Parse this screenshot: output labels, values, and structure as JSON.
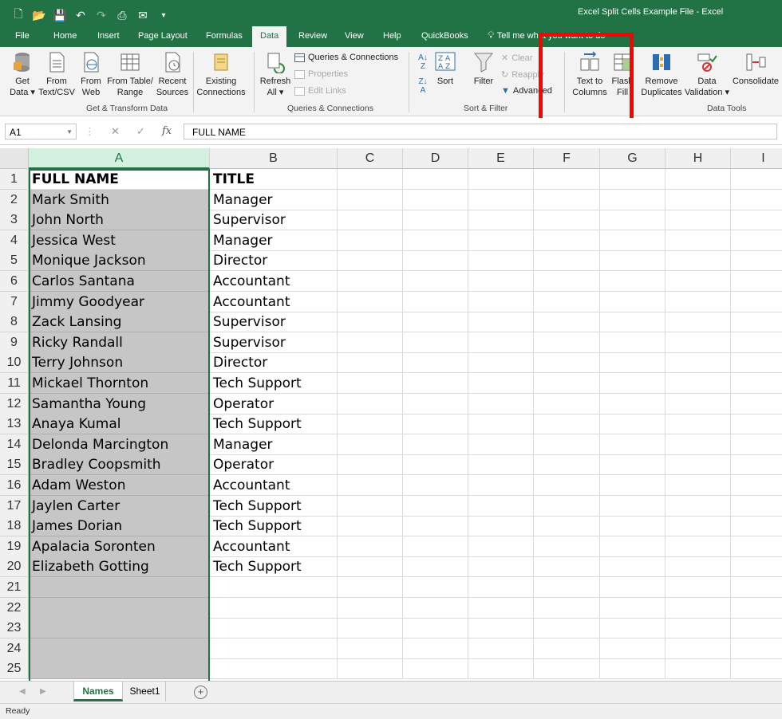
{
  "window": {
    "title": "Excel Split Cells Example File  -  Excel"
  },
  "qat": {
    "icons": [
      "new-file-icon",
      "open-icon",
      "save-icon",
      "undo-icon",
      "redo-icon",
      "camera-icon",
      "email-icon",
      "customize-icon"
    ]
  },
  "tabs": [
    {
      "label": "File"
    },
    {
      "label": "Home"
    },
    {
      "label": "Insert"
    },
    {
      "label": "Page Layout"
    },
    {
      "label": "Formulas"
    },
    {
      "label": "Data"
    },
    {
      "label": "Review"
    },
    {
      "label": "View"
    },
    {
      "label": "Help"
    },
    {
      "label": "QuickBooks"
    }
  ],
  "active_tab": "Data",
  "tell_me": "Tell me what you want to do",
  "ribbon": {
    "get_data": "Get\nData ▾",
    "from_text": "From\nText/CSV",
    "from_web": "From\nWeb",
    "from_table": "From Table/\nRange",
    "recent_sources": "Recent\nSources",
    "existing_connections": "Existing\nConnections",
    "refresh_all": "Refresh\nAll ▾",
    "queries_connections": "Queries & Connections",
    "properties": "Properties",
    "edit_links": "Edit Links",
    "sort": "Sort",
    "filter": "Filter",
    "clear": "Clear",
    "reapply": "Reapply",
    "advanced": "Advanced",
    "text_to_columns": "Text to\nColumns",
    "flash_fill": "Flash\nFill",
    "remove_duplicates": "Remove\nDuplicates",
    "data_validation": "Data\nValidation ▾",
    "consolidate": "Consolidate",
    "group_get_transform": "Get & Transform Data",
    "group_queries": "Queries & Connections",
    "group_sort_filter": "Sort & Filter",
    "group_data_tools": "Data Tools"
  },
  "formula_bar": {
    "name_box": "A1",
    "fx": "fx",
    "content": "FULL NAME"
  },
  "columns": [
    "A",
    "B",
    "C",
    "D",
    "E",
    "F",
    "G",
    "H",
    "I"
  ],
  "rows": [
    {
      "n": "1",
      "a": "FULL NAME",
      "b": "TITLE"
    },
    {
      "n": "2",
      "a": "Mark Smith",
      "b": "Manager"
    },
    {
      "n": "3",
      "a": "John North",
      "b": "Supervisor"
    },
    {
      "n": "4",
      "a": "Jessica West",
      "b": "Manager"
    },
    {
      "n": "5",
      "a": "Monique Jackson",
      "b": "Director"
    },
    {
      "n": "6",
      "a": "Carlos Santana",
      "b": "Accountant"
    },
    {
      "n": "7",
      "a": "Jimmy Goodyear",
      "b": "Accountant"
    },
    {
      "n": "8",
      "a": "Zack Lansing",
      "b": "Supervisor"
    },
    {
      "n": "9",
      "a": "Ricky Randall",
      "b": "Supervisor"
    },
    {
      "n": "10",
      "a": "Terry Johnson",
      "b": "Director"
    },
    {
      "n": "11",
      "a": "Mickael Thornton",
      "b": "Tech Support"
    },
    {
      "n": "12",
      "a": "Samantha Young",
      "b": "Operator"
    },
    {
      "n": "13",
      "a": "Anaya Kumal",
      "b": "Tech Support"
    },
    {
      "n": "14",
      "a": "Delonda Marcington",
      "b": "Manager"
    },
    {
      "n": "15",
      "a": "Bradley Coopsmith",
      "b": "Operator"
    },
    {
      "n": "16",
      "a": "Adam Weston",
      "b": "Accountant"
    },
    {
      "n": "17",
      "a": "Jaylen Carter",
      "b": "Tech Support"
    },
    {
      "n": "18",
      "a": "James Dorian",
      "b": "Tech Support"
    },
    {
      "n": "19",
      "a": "Apalacia Soronten",
      "b": "Accountant"
    },
    {
      "n": "20",
      "a": "Elizabeth Gotting",
      "b": "Tech Support"
    },
    {
      "n": "21",
      "a": "",
      "b": ""
    },
    {
      "n": "22",
      "a": "",
      "b": ""
    },
    {
      "n": "23",
      "a": "",
      "b": ""
    },
    {
      "n": "24",
      "a": "",
      "b": ""
    },
    {
      "n": "25",
      "a": "",
      "b": ""
    }
  ],
  "sheets": [
    {
      "label": "Names"
    },
    {
      "label": "Sheet1"
    }
  ],
  "active_sheet": "Names",
  "status": "Ready",
  "colors": {
    "excel_green": "#217346",
    "highlight_box": "#ff0000",
    "selection_fill": "#c6c6c6"
  }
}
